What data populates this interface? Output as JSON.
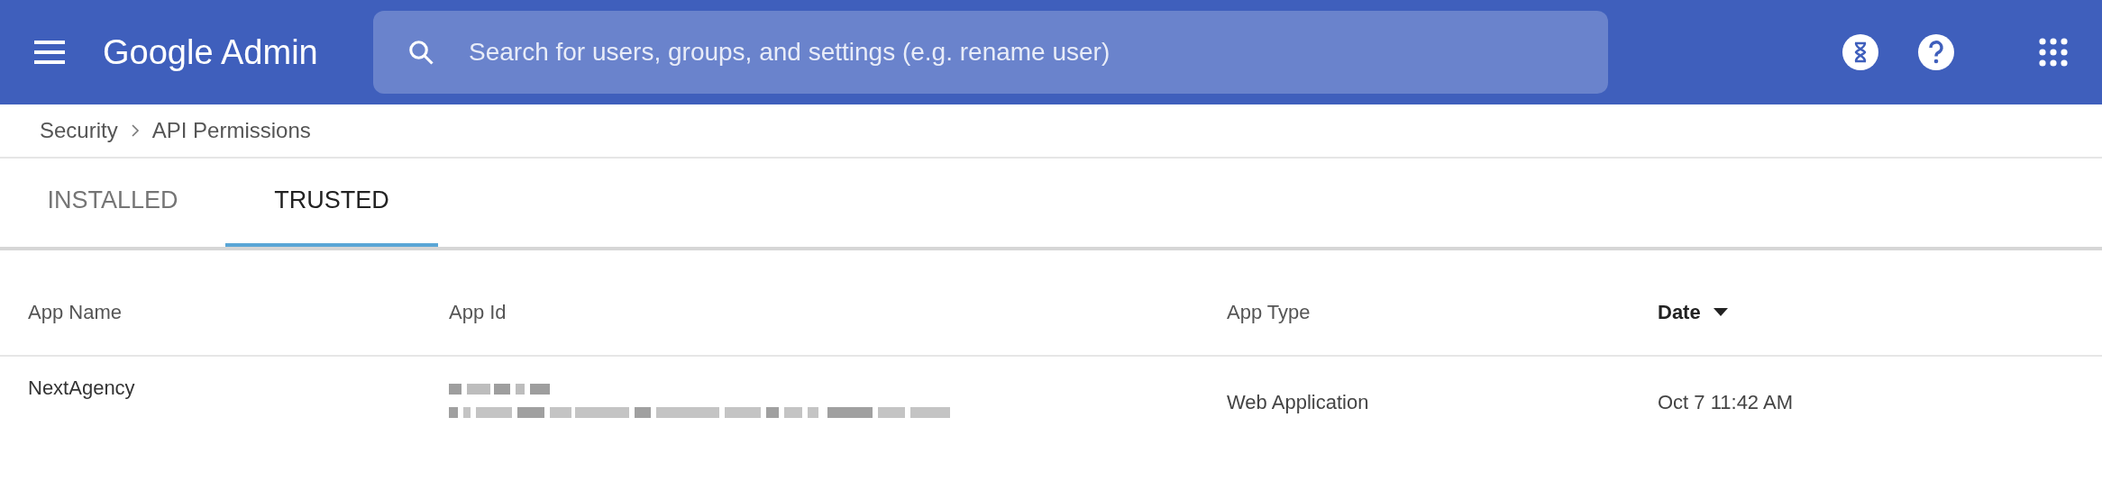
{
  "header": {
    "title": "Google Admin",
    "search": {
      "placeholder": "Search for users, groups, and settings (e.g. rename user)"
    }
  },
  "breadcrumb": [
    "Security",
    "API Permissions"
  ],
  "tabs": [
    {
      "label": "INSTALLED",
      "selected": false
    },
    {
      "label": "TRUSTED",
      "selected": true
    }
  ],
  "table": {
    "columns": [
      {
        "label": "App Name",
        "sorted": false
      },
      {
        "label": "App Id",
        "sorted": false
      },
      {
        "label": "App Type",
        "sorted": false
      },
      {
        "label": "Date",
        "sorted": true
      }
    ],
    "rows": [
      {
        "app_name": "NextAgency",
        "app_type": "Web Application",
        "date": "Oct 7 11:42 AM"
      }
    ]
  }
}
